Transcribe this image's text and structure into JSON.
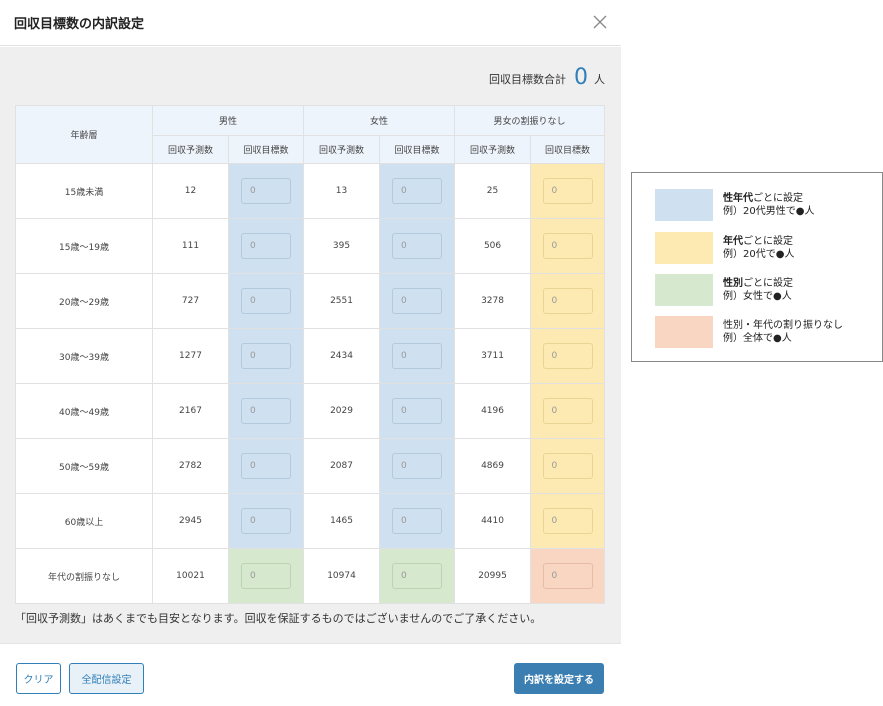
{
  "dialog": {
    "title": "回収目標数の内訳設定",
    "total_label": "回収目標数合計",
    "total_value": "0",
    "total_unit": "人",
    "note": "「回収予測数」はあくまでも目安となります。回収を保証するものではございませんのでご了承ください。"
  },
  "table": {
    "age_header": "年齢層",
    "groups": [
      "男性",
      "女性",
      "男女の割振りなし"
    ],
    "sub_headers": {
      "predicted": "回収予測数",
      "target": "回収目標数"
    },
    "rows": [
      {
        "age": "15歳未満",
        "male_pred": "12",
        "male_target": "0",
        "female_pred": "13",
        "female_target": "0",
        "both_pred": "25",
        "both_target": "0"
      },
      {
        "age": "15歳〜19歳",
        "male_pred": "111",
        "male_target": "0",
        "female_pred": "395",
        "female_target": "0",
        "both_pred": "506",
        "both_target": "0"
      },
      {
        "age": "20歳〜29歳",
        "male_pred": "727",
        "male_target": "0",
        "female_pred": "2551",
        "female_target": "0",
        "both_pred": "3278",
        "both_target": "0"
      },
      {
        "age": "30歳〜39歳",
        "male_pred": "1277",
        "male_target": "0",
        "female_pred": "2434",
        "female_target": "0",
        "both_pred": "3711",
        "both_target": "0"
      },
      {
        "age": "40歳〜49歳",
        "male_pred": "2167",
        "male_target": "0",
        "female_pred": "2029",
        "female_target": "0",
        "both_pred": "4196",
        "both_target": "0"
      },
      {
        "age": "50歳〜59歳",
        "male_pred": "2782",
        "male_target": "0",
        "female_pred": "2087",
        "female_target": "0",
        "both_pred": "4869",
        "both_target": "0"
      },
      {
        "age": "60歳以上",
        "male_pred": "2945",
        "male_target": "0",
        "female_pred": "1465",
        "female_target": "0",
        "both_pred": "4410",
        "both_target": "0"
      },
      {
        "age": "年代の割振りなし",
        "male_pred": "10021",
        "male_target": "0",
        "female_pred": "10974",
        "female_target": "0",
        "both_pred": "20995",
        "both_target": "0"
      }
    ]
  },
  "footer": {
    "clear_label": "クリア",
    "all_delivery_label": "全配信設定",
    "submit_label": "内訳を設定する"
  },
  "legend": {
    "items": [
      {
        "bold": "性年代",
        "rest": "ごとに設定",
        "example": "例）20代男性で●人",
        "color": "#cfe0f0"
      },
      {
        "bold": "年代",
        "rest": "ごとに設定",
        "example": "例）20代で●人",
        "color": "#fdeab3"
      },
      {
        "bold": "性別",
        "rest": "ごとに設定",
        "example": "例）女性で●人",
        "color": "#d6e8cd"
      },
      {
        "bold": "",
        "rest": "性別・年代の割り振りなし",
        "example": "例）全体で●人",
        "color": "#f8d6c2"
      }
    ]
  },
  "colors": {
    "accent": "#2f7fb8",
    "gender_age": "#cfe0f0",
    "age": "#fdeab3",
    "gender": "#d6e8cd",
    "none": "#f8d6c2"
  }
}
